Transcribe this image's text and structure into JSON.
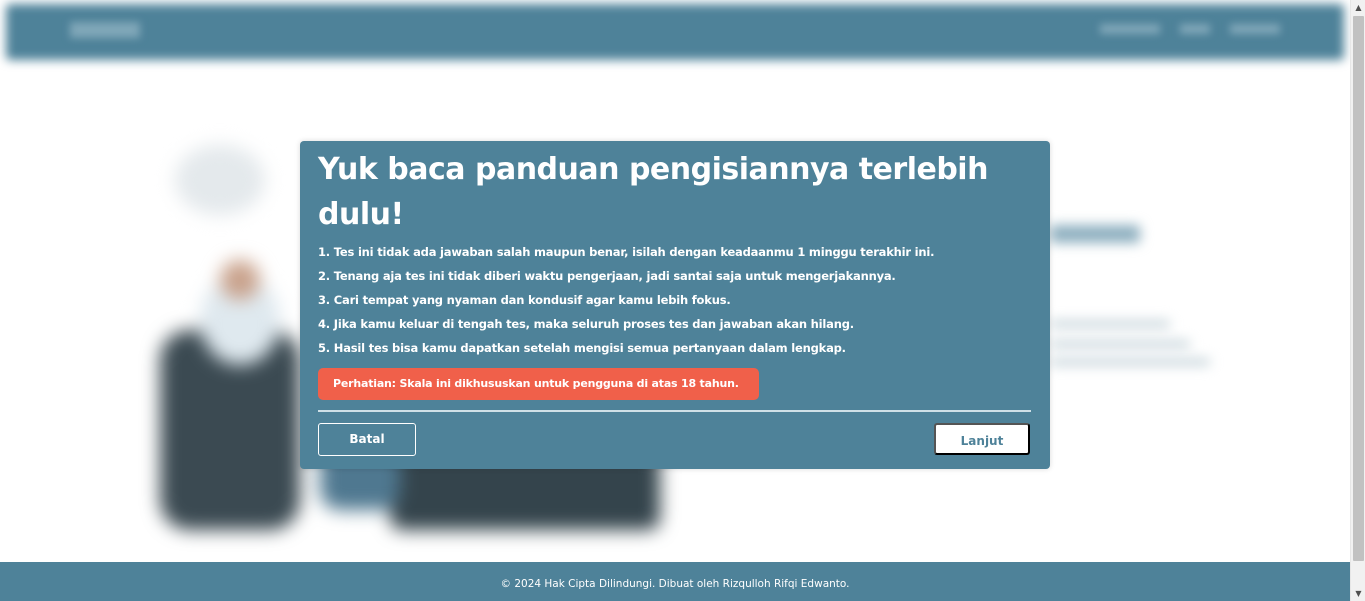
{
  "modal": {
    "title": "Yuk baca panduan pengisiannya terlebih dulu!",
    "guidelines": [
      "1. Tes ini tidak ada jawaban salah maupun benar, isilah dengan keadaanmu 1 minggu terakhir ini.",
      "2. Tenang aja tes ini tidak diberi waktu pengerjaan, jadi santai saja untuk mengerjakannya.",
      "3. Cari tempat yang nyaman dan kondusif agar kamu lebih fokus.",
      "4. Jika kamu keluar di tengah tes, maka seluruh proses tes dan jawaban akan hilang.",
      "5. Hasil tes bisa kamu dapatkan setelah mengisi semua pertanyaan dalam lengkap."
    ],
    "warning": "Perhatian: Skala ini dikhususkan untuk pengguna di atas 18 tahun.",
    "cancel_label": "Batal",
    "next_label": "Lanjut"
  },
  "footer": {
    "text": "© 2024 Hak Cipta Dilindungi. Dibuat oleh Rizqulloh Rifqi Edwanto."
  },
  "colors": {
    "primary": "#4e8299",
    "warning": "#f0604a",
    "text_on_primary": "#ffffff"
  }
}
